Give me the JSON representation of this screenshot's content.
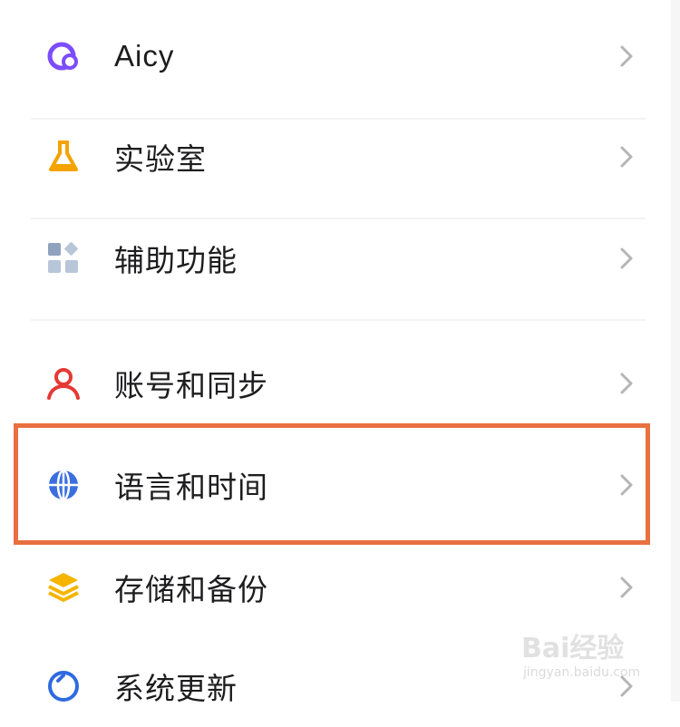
{
  "settings": {
    "items": [
      {
        "label": "Aicy",
        "icon": "aicy-icon"
      },
      {
        "label": "实验室",
        "icon": "flask-icon"
      },
      {
        "label": "辅助功能",
        "icon": "accessibility-grid-icon"
      },
      {
        "label": "账号和同步",
        "icon": "person-icon"
      },
      {
        "label": "语言和时间",
        "icon": "globe-icon"
      },
      {
        "label": "存储和备份",
        "icon": "layers-icon"
      },
      {
        "label": "系统更新",
        "icon": "update-circle-icon"
      }
    ]
  },
  "colors": {
    "highlight_border": "#e9703f",
    "aicy": "#7b4dff",
    "flask": "#f4a300",
    "accessibility": "#8fa3bf",
    "account": "#e53935",
    "globe": "#3b6fe0",
    "storage": "#f5b400",
    "update": "#2f6be0"
  },
  "watermark": {
    "text": "Bai经验",
    "sub": "jingyan.baidu.com"
  }
}
